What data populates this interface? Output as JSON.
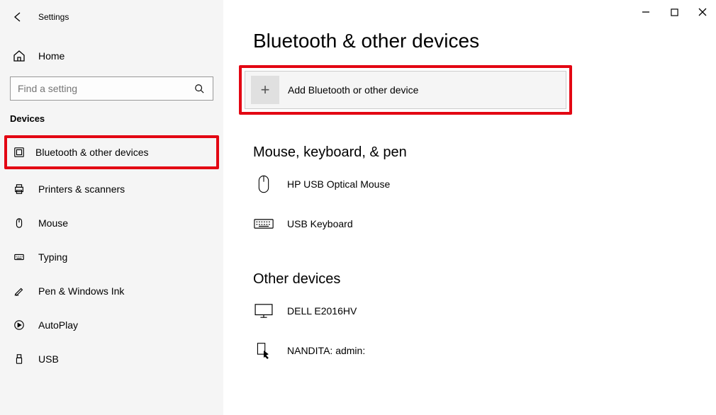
{
  "app_title": "Settings",
  "home_label": "Home",
  "search_placeholder": "Find a setting",
  "sidebar_section": "Devices",
  "nav": {
    "bluetooth": "Bluetooth & other devices",
    "printers": "Printers & scanners",
    "mouse": "Mouse",
    "typing": "Typing",
    "pen": "Pen & Windows Ink",
    "autoplay": "AutoPlay",
    "usb": "USB"
  },
  "page_title": "Bluetooth & other devices",
  "add_button": "Add Bluetooth or other device",
  "section_mkp": "Mouse, keyboard, & pen",
  "dev_mouse": "HP USB Optical Mouse",
  "dev_keyboard": "USB Keyboard",
  "section_other": "Other devices",
  "dev_monitor": "DELL E2016HV",
  "dev_remote": "NANDITA: admin:"
}
